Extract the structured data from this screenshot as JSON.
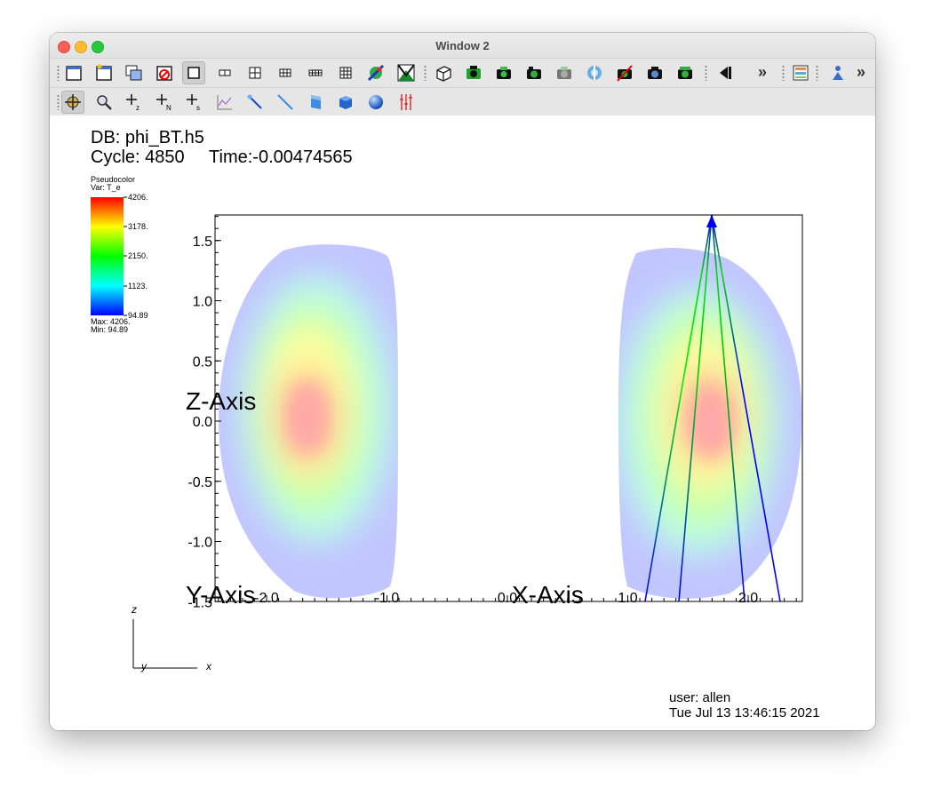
{
  "window": {
    "title": "Window 2"
  },
  "toolbar_main": {
    "icons": [
      "new-window-icon",
      "window-frame-icon",
      "copy-window-icon",
      "delete-window-icon",
      "layout-1x1-icon",
      "layout-1x2-icon",
      "layout-2x2-icon",
      "layout-2x3-icon",
      "layout-2x4-icon",
      "layout-3x3-icon",
      "spin-mode-icon",
      "lock-icon",
      "view-cube-icon",
      "camera-icon",
      "camera-2-icon",
      "camera-3-icon",
      "camera-4-icon",
      "camera-5-icon",
      "camera-6-icon",
      "camera-7-icon",
      "camera-8-icon",
      "step-back-icon",
      "expand-toolbar-icon",
      "plot-list-icon",
      "operator-icon",
      "expand-toolbar-2-icon"
    ]
  },
  "toolbar_interaction": {
    "icons": [
      "navigate-icon",
      "zoom-icon",
      "zone-pick-icon",
      "node-pick-icon",
      "spreadsheet-pick-icon",
      "curve-pick-icon",
      "pick-arrow-icon",
      "lineout-icon",
      "plane-tool-icon",
      "box-tool-icon",
      "sphere-tool-icon",
      "axis-restrict-icon"
    ]
  },
  "annotation": {
    "db": "DB: phi_BT.h5",
    "cycle_time": "Cycle: 4850     Time:-0.00474565",
    "user": "user: allen",
    "date": "Tue Jul 13 13:46:15 2021"
  },
  "legend": {
    "title": "Pseudocolor",
    "var": "Var: T_e",
    "ticks": [
      "4206.",
      "3178.",
      "2150.",
      "1123.",
      "94.89"
    ],
    "max": "Max:  4206.",
    "min": "Min:  94.89"
  },
  "axes": {
    "z_title": "Z-Axis",
    "y_title": "Y-Axis",
    "x_title": "X-Axis",
    "z_ticks": [
      "1.5",
      "1.0",
      "0.5",
      "0.0",
      "-0.5",
      "-1.0",
      "-1.5"
    ],
    "x_ticks": [
      "-2.0",
      "-1.0",
      "0.0",
      "1.0",
      "2.0"
    ],
    "triad": {
      "z": "z",
      "y": "y",
      "x": "x"
    }
  },
  "colors": {
    "max": "#ff0000",
    "min": "#0000ff",
    "background": "#ffffff"
  }
}
